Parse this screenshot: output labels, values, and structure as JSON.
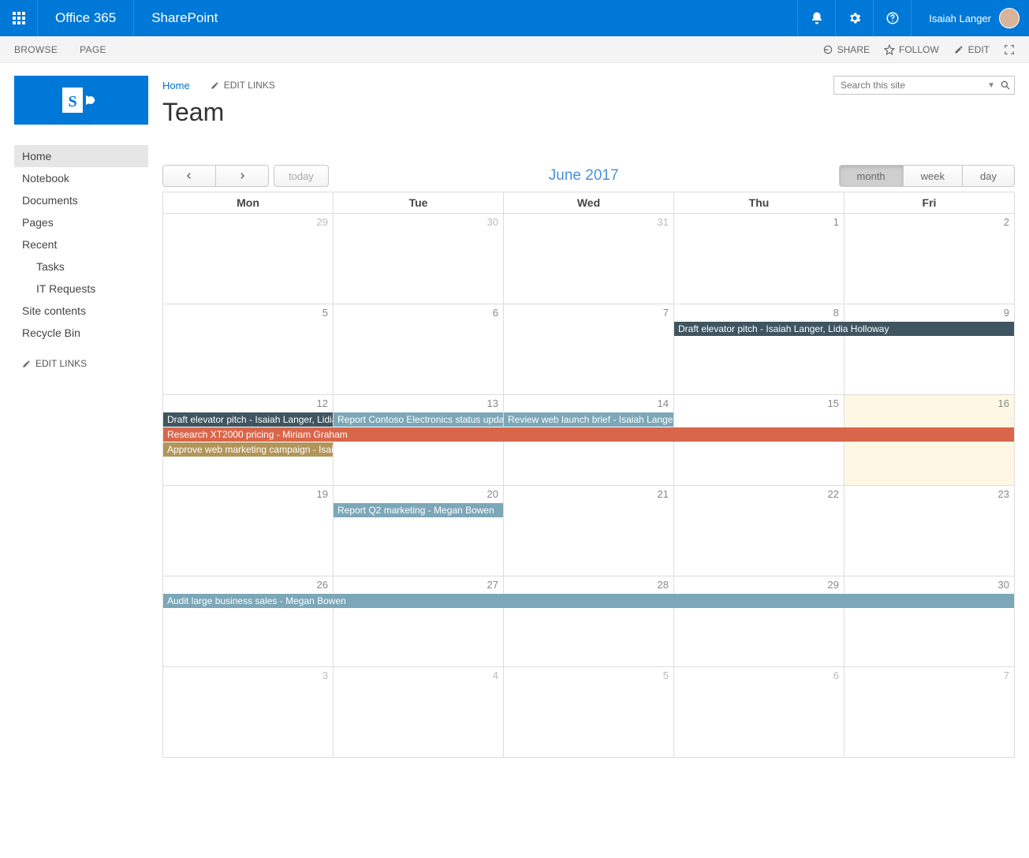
{
  "suitebar": {
    "brand1": "Office 365",
    "brand2": "SharePoint",
    "username": "Isaiah Langer"
  },
  "ribbon": {
    "tabs": [
      "BROWSE",
      "PAGE"
    ],
    "actions": {
      "share": "SHARE",
      "follow": "FOLLOW",
      "edit": "EDIT"
    }
  },
  "breadcrumb": {
    "home": "Home",
    "editlinks": "EDIT LINKS"
  },
  "search": {
    "placeholder": "Search this site"
  },
  "page_title": "Team",
  "nav": {
    "items": [
      {
        "label": "Home",
        "active": true
      },
      {
        "label": "Notebook"
      },
      {
        "label": "Documents"
      },
      {
        "label": "Pages"
      },
      {
        "label": "Recent"
      },
      {
        "label": "Tasks",
        "sub": true
      },
      {
        "label": "IT Requests",
        "sub": true
      },
      {
        "label": "Site contents"
      },
      {
        "label": "Recycle Bin"
      }
    ],
    "editlinks": "EDIT LINKS"
  },
  "calendar": {
    "title": "June 2017",
    "today_btn": "today",
    "views": {
      "month": "month",
      "week": "week",
      "day": "day"
    },
    "active_view": "month",
    "headers": [
      "Mon",
      "Tue",
      "Wed",
      "Thu",
      "Fri"
    ],
    "weeks": [
      {
        "days": [
          {
            "num": "29",
            "other": true
          },
          {
            "num": "30",
            "other": true
          },
          {
            "num": "31",
            "other": true
          },
          {
            "num": "1"
          },
          {
            "num": "2"
          }
        ],
        "events": []
      },
      {
        "days": [
          {
            "num": "5"
          },
          {
            "num": "6"
          },
          {
            "num": "7"
          },
          {
            "num": "8"
          },
          {
            "num": "9"
          }
        ],
        "events": [
          {
            "title": "Draft elevator pitch - Isaiah Langer, Lidia Holloway",
            "color": "c-dark",
            "start": 3,
            "span": 2
          }
        ]
      },
      {
        "days": [
          {
            "num": "12"
          },
          {
            "num": "13"
          },
          {
            "num": "14"
          },
          {
            "num": "15"
          },
          {
            "num": "16",
            "today": true
          }
        ],
        "events": [
          {
            "title": "Draft elevator pitch - Isaiah Langer, Lidia Holloway",
            "color": "c-dark",
            "start": 0,
            "span": 1
          },
          {
            "title": "Report Contoso Electronics status update - Isaiah Langer",
            "color": "c-blue",
            "start": 1,
            "span": 1
          },
          {
            "title": "Review web launch brief - Isaiah Langer",
            "color": "c-blue",
            "start": 2,
            "span": 1
          },
          {
            "row": 1,
            "title": "Research XT2000 pricing - Miriam Graham",
            "color": "c-orange",
            "start": 0,
            "span": 5
          },
          {
            "row": 2,
            "title": "Approve web marketing campaign - Isaiah Langer",
            "color": "c-olive",
            "start": 0,
            "span": 1
          }
        ]
      },
      {
        "days": [
          {
            "num": "19"
          },
          {
            "num": "20"
          },
          {
            "num": "21"
          },
          {
            "num": "22"
          },
          {
            "num": "23"
          }
        ],
        "events": [
          {
            "title": "Report Q2 marketing - Megan Bowen",
            "color": "c-blue",
            "start": 1,
            "span": 1
          }
        ]
      },
      {
        "days": [
          {
            "num": "26"
          },
          {
            "num": "27"
          },
          {
            "num": "28"
          },
          {
            "num": "29"
          },
          {
            "num": "30"
          }
        ],
        "events": [
          {
            "title": "Audit large business sales - Megan Bowen",
            "color": "c-blue",
            "start": 0,
            "span": 5
          }
        ]
      },
      {
        "days": [
          {
            "num": "3",
            "other": true
          },
          {
            "num": "4",
            "other": true
          },
          {
            "num": "5",
            "other": true
          },
          {
            "num": "6",
            "other": true
          },
          {
            "num": "7",
            "other": true
          }
        ],
        "events": []
      }
    ]
  }
}
